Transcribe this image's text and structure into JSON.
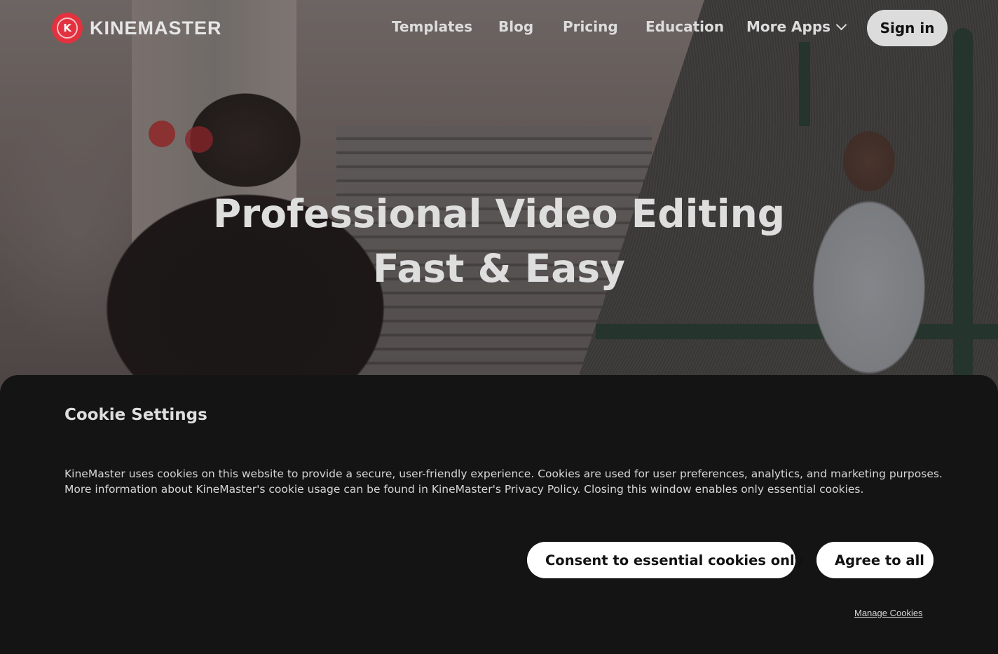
{
  "brand": {
    "name": "KINEMASTER",
    "mark_letter": "K",
    "accent": "#e2323f"
  },
  "nav": {
    "links": [
      "Templates",
      "Blog",
      "Pricing",
      "Education",
      "More Apps"
    ],
    "more_icon": "chevron-down-icon",
    "signin_label": "Sign in"
  },
  "hero": {
    "title_line1": "Professional Video Editing",
    "title_line2": "Fast & Easy"
  },
  "cookie": {
    "title": "Cookie Settings",
    "text": "KineMaster uses cookies on this website to provide a secure, user-friendly experience. Cookies are used for user preferences, analytics, and marketing purposes. More information about KineMaster's cookie usage can be found in KineMaster's Privacy Policy. Closing this window enables only essential cookies.",
    "essential_label": "Consent to essential cookies only",
    "agree_label": "Agree to all",
    "manage_label": "Manage Cookies"
  },
  "colors": {
    "panel_bg": "#141414",
    "button_bg": "#ffffff",
    "signin_bg": "#dcdcdc"
  }
}
